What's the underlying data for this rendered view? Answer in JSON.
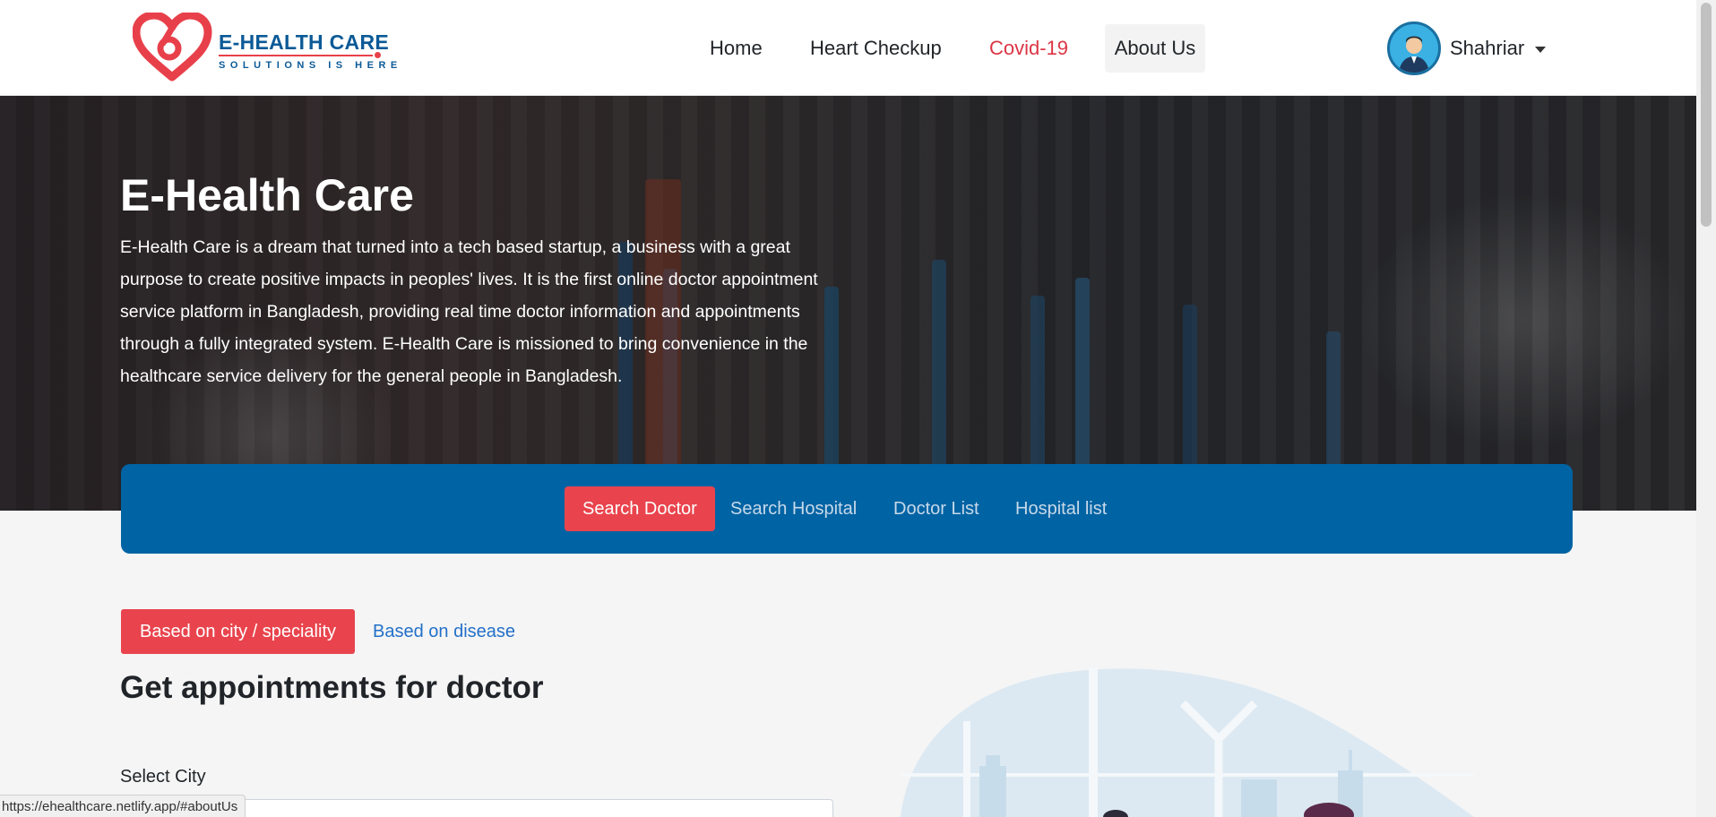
{
  "brand": {
    "name": "E-HEALTH CARE",
    "tagline": "SOLUTIONS IS HERE",
    "primary_color": "#0b5a97",
    "accent_color": "#e8404a"
  },
  "nav": {
    "items": [
      {
        "label": "Home"
      },
      {
        "label": "Heart Checkup"
      },
      {
        "label": "Covid-19"
      },
      {
        "label": "About Us"
      }
    ]
  },
  "user": {
    "name": "Shahriar",
    "avatar_icon": "user-avatar-icon"
  },
  "hero": {
    "title": "E-Health Care",
    "description": "E-Health Care is a dream that turned into a tech based startup, a business with a great purpose to create positive impacts in peoples' lives. It is the first online doctor appointment service platform in Bangladesh, providing real time doctor information and appointments through a fully integrated system. E-Health Care is missioned to bring convenience in the healthcare service delivery for the general people in Bangladesh."
  },
  "search_tabs": {
    "items": [
      {
        "label": "Search Doctor",
        "active": true
      },
      {
        "label": "Search Hospital"
      },
      {
        "label": "Doctor List"
      },
      {
        "label": "Hospital list"
      }
    ],
    "panel_color": "#0063a3",
    "active_color": "#e9444d"
  },
  "doctor_search": {
    "filters": [
      {
        "label": "Based on city / speciality",
        "active": true
      },
      {
        "label": "Based on disease"
      }
    ],
    "title": "Get appointments for doctor",
    "city_label": "Select City",
    "city_value": ""
  },
  "status_bar": {
    "url": "https://ehealthcare.netlify.app/#aboutUs"
  }
}
